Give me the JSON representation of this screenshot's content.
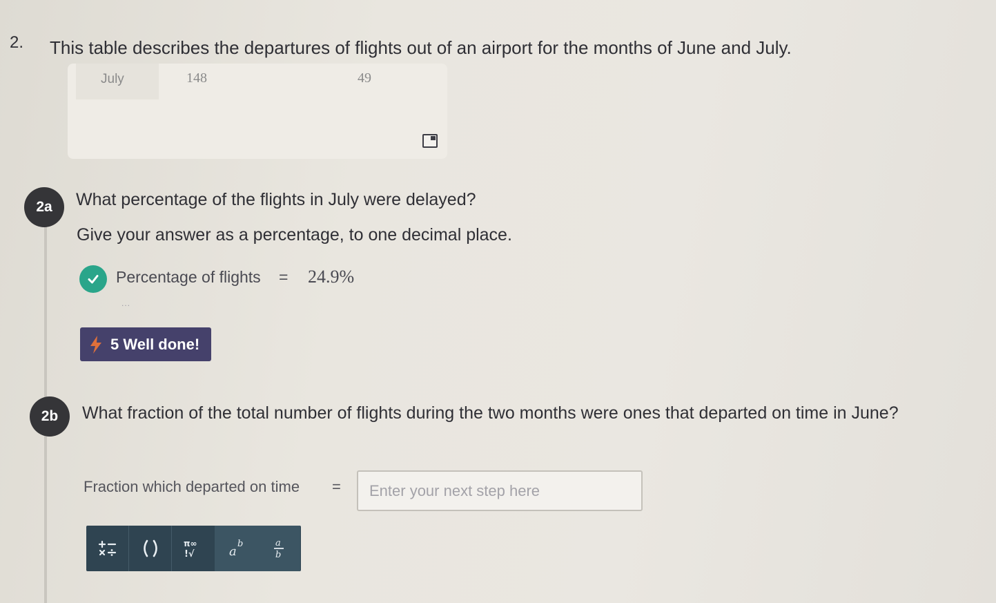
{
  "question": {
    "number": "2.",
    "text": "This table describes the departures of flights out of an airport for the months of June and July."
  },
  "table": {
    "row": {
      "month": "July",
      "col2": "148",
      "col3": "49"
    }
  },
  "part_a": {
    "badge": "2a",
    "question": "What percentage of the flights in July were delayed?",
    "instruction": "Give your answer as a percentage, to one decimal place.",
    "answer_label": "Percentage of flights",
    "equals": "=",
    "answer_value": "24.9%",
    "more": "...",
    "reward_text": "5 Well done!"
  },
  "part_b": {
    "badge": "2b",
    "question": "What fraction of the total number of flights during the two months were ones that departed on time in June?",
    "input_label": "Fraction which departed on time",
    "equals": "=",
    "input_placeholder": "Enter your next step here",
    "input_value": ""
  },
  "math_toolbar": {
    "tools": [
      {
        "name": "operators-icon",
        "glyph": "+− ×÷"
      },
      {
        "name": "brackets-icon",
        "glyph": "( )"
      },
      {
        "name": "symbols-icon",
        "glyph": "π∞ !√"
      },
      {
        "name": "power-icon",
        "glyph": "a^b"
      },
      {
        "name": "fraction-icon",
        "glyph": "a/b"
      }
    ]
  },
  "colors": {
    "check": "#2aa58a",
    "reward_bg": "#45416b",
    "toolbar_bg": "#2f4451",
    "badge_bg": "#353538"
  }
}
